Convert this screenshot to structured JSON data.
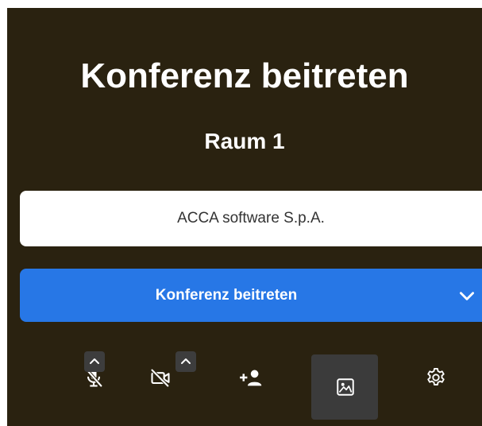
{
  "prejoin": {
    "title": "Konferenz beitreten",
    "room_name": "Raum 1",
    "display_name_value": "ACCA software S.p.A.",
    "join_button_label": "Konferenz beitreten"
  },
  "toolbar": {
    "items": [
      {
        "name": "microphone",
        "icon": "microphone-muted-icon",
        "state": "muted",
        "has_options_caret": true
      },
      {
        "name": "camera",
        "icon": "camera-off-icon",
        "state": "off",
        "has_options_caret": true
      },
      {
        "name": "invite",
        "icon": "add-person-icon"
      },
      {
        "name": "virtual-background",
        "icon": "image-icon",
        "active": true
      },
      {
        "name": "settings",
        "icon": "gear-icon"
      }
    ]
  },
  "colors": {
    "panel_background": "#2a2210",
    "primary_button": "#2777e6",
    "text": "#ffffff"
  }
}
